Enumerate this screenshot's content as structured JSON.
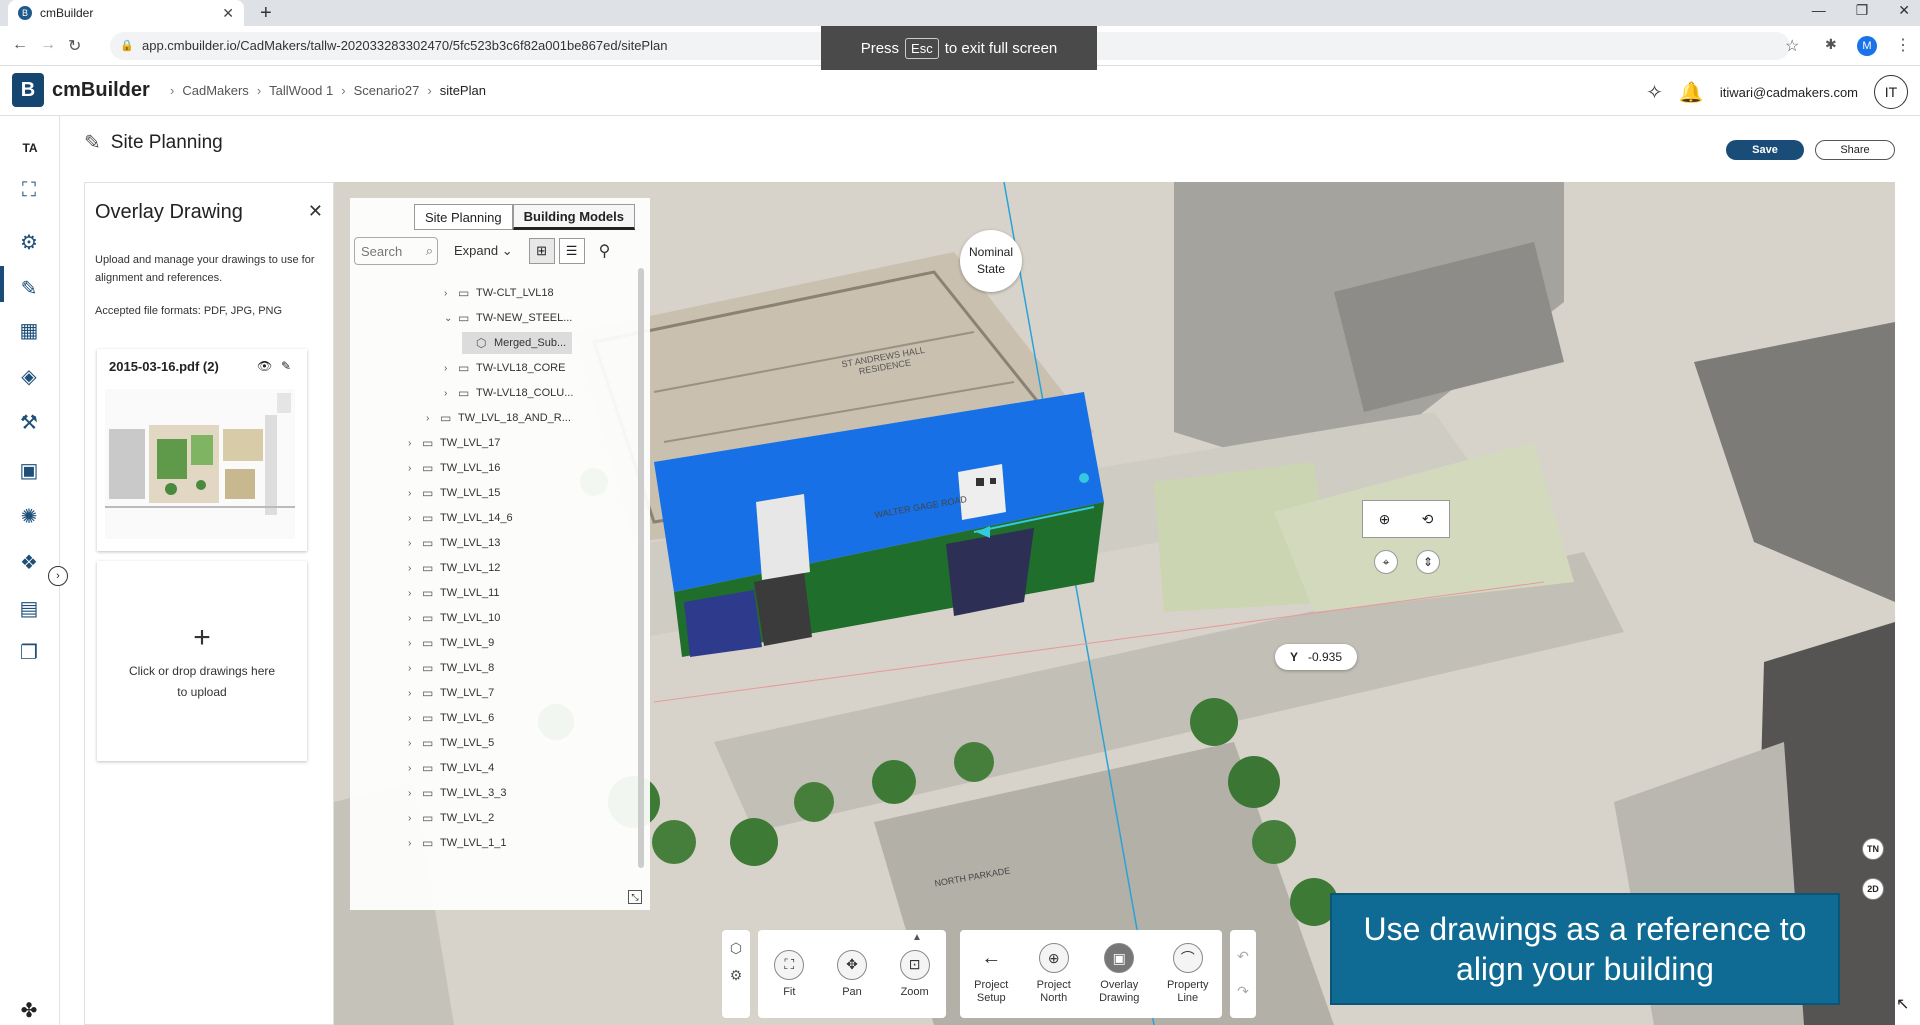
{
  "browser": {
    "tab_title": "cmBuilder",
    "tab_favicon": "B",
    "url": "app.cmbuilder.io/CadMakers/tallw-202033283302470/5fc523b3c6f82a001be867ed/sitePlan",
    "profile_initial": "M",
    "fullscreen_press": "Press",
    "fullscreen_key": "Esc",
    "fullscreen_suffix": "to exit full screen"
  },
  "app": {
    "brand": "cmBuilder",
    "logo_letter": "B",
    "breadcrumbs": [
      "CadMakers",
      "TallWood 1",
      "Scenario27",
      "sitePlan"
    ],
    "user_email": "itiwari@cadmakers.com",
    "user_initials": "IT",
    "rail_initials": "TA"
  },
  "page": {
    "title": "Site Planning",
    "save_label": "Save",
    "share_label": "Share"
  },
  "overlay": {
    "title": "Overlay Drawing",
    "description": "Upload and manage your drawings to use for alignment and references.",
    "formats": "Accepted file formats: PDF, JPG, PNG",
    "file_name": "2015-03-16.pdf (2)",
    "upload_text": "Click or drop drawings here to upload"
  },
  "tree": {
    "tabs": [
      "Site Planning",
      "Building Models"
    ],
    "selected_tab": "Building Models",
    "search_placeholder": "Search",
    "expand_label": "Expand",
    "rows": [
      {
        "label": "TW-CLT_LVL18",
        "depth": 3,
        "icon": "folder",
        "caret": "right"
      },
      {
        "label": "TW-NEW_STEEL...",
        "depth": 3,
        "icon": "folder",
        "caret": "down"
      },
      {
        "label": "Merged_Sub...",
        "depth": 4,
        "icon": "cube",
        "caret": "",
        "selected": true
      },
      {
        "label": "TW-LVL18_CORE",
        "depth": 3,
        "icon": "folder",
        "caret": "right"
      },
      {
        "label": "TW-LVL18_COLU...",
        "depth": 3,
        "icon": "folder",
        "caret": "right"
      },
      {
        "label": "TW_LVL_18_AND_R...",
        "depth": 2,
        "icon": "folder",
        "caret": "right"
      },
      {
        "label": "TW_LVL_17",
        "depth": 1,
        "icon": "folder",
        "caret": "right"
      },
      {
        "label": "TW_LVL_16",
        "depth": 1,
        "icon": "folder",
        "caret": "right"
      },
      {
        "label": "TW_LVL_15",
        "depth": 1,
        "icon": "folder",
        "caret": "right"
      },
      {
        "label": "TW_LVL_14_6",
        "depth": 1,
        "icon": "folder",
        "caret": "right"
      },
      {
        "label": "TW_LVL_13",
        "depth": 1,
        "icon": "folder",
        "caret": "right"
      },
      {
        "label": "TW_LVL_12",
        "depth": 1,
        "icon": "folder",
        "caret": "right"
      },
      {
        "label": "TW_LVL_11",
        "depth": 1,
        "icon": "folder",
        "caret": "right"
      },
      {
        "label": "TW_LVL_10",
        "depth": 1,
        "icon": "folder",
        "caret": "right"
      },
      {
        "label": "TW_LVL_9",
        "depth": 1,
        "icon": "folder",
        "caret": "right"
      },
      {
        "label": "TW_LVL_8",
        "depth": 1,
        "icon": "folder",
        "caret": "right"
      },
      {
        "label": "TW_LVL_7",
        "depth": 1,
        "icon": "folder",
        "caret": "right"
      },
      {
        "label": "TW_LVL_6",
        "depth": 1,
        "icon": "folder",
        "caret": "right"
      },
      {
        "label": "TW_LVL_5",
        "depth": 1,
        "icon": "folder",
        "caret": "right"
      },
      {
        "label": "TW_LVL_4",
        "depth": 1,
        "icon": "folder",
        "caret": "right"
      },
      {
        "label": "TW_LVL_3_3",
        "depth": 1,
        "icon": "folder",
        "caret": "right"
      },
      {
        "label": "TW_LVL_2",
        "depth": 1,
        "icon": "folder",
        "caret": "right"
      },
      {
        "label": "TW_LVL_1_1",
        "depth": 1,
        "icon": "folder",
        "caret": "right"
      }
    ]
  },
  "map": {
    "nominal_state": "Nominal State",
    "y_label": "Y",
    "y_value": "-0.935",
    "map_text_1": "ST ANDREWS HALL RESIDENCE",
    "map_text_2": "WALTER GAGE ROAD",
    "map_text_3": "NORTH PARKADE",
    "compass_label": "TN",
    "view_mode": "2D",
    "tutorial_text": "Use drawings as a reference to align your building"
  },
  "toolbar": {
    "fit": "Fit",
    "pan": "Pan",
    "zoom": "Zoom",
    "project_setup": "Project Setup",
    "project_north": "Project North",
    "overlay_drawing": "Overlay Drawing",
    "property_line": "Property Line"
  },
  "colors": {
    "brand": "#15466f",
    "building_roof": "#1770e6",
    "tutorial_bg": "#0f6b93"
  }
}
